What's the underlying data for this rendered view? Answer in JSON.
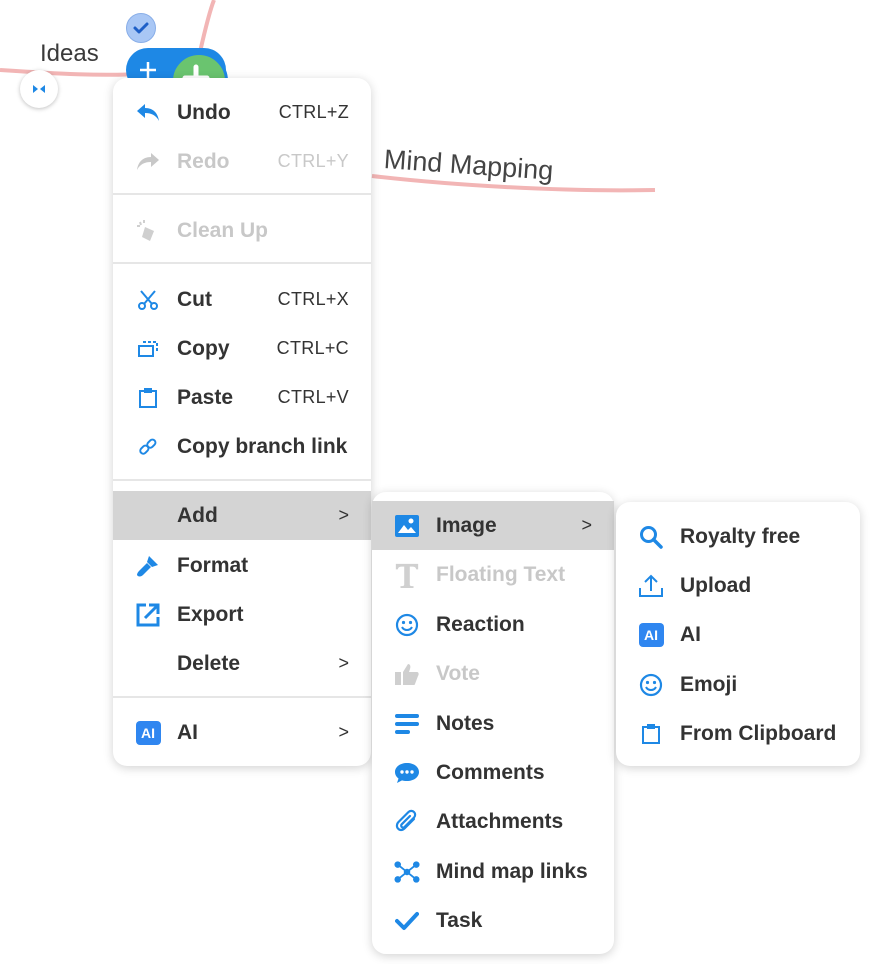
{
  "canvas": {
    "node_ideas": "Ideas",
    "node_mindmap": "Mind Mapping"
  },
  "main_menu": {
    "undo": {
      "label": "Undo",
      "shortcut": "CTRL+Z"
    },
    "redo": {
      "label": "Redo",
      "shortcut": "CTRL+Y"
    },
    "cleanup": {
      "label": "Clean Up"
    },
    "cut": {
      "label": "Cut",
      "shortcut": "CTRL+X"
    },
    "copy": {
      "label": "Copy",
      "shortcut": "CTRL+C"
    },
    "paste": {
      "label": "Paste",
      "shortcut": "CTRL+V"
    },
    "copy_branch": {
      "label": "Copy branch link"
    },
    "add": {
      "label": "Add",
      "arrow": ">"
    },
    "format": {
      "label": "Format"
    },
    "export": {
      "label": "Export"
    },
    "delete": {
      "label": "Delete",
      "arrow": ">"
    },
    "ai": {
      "label": "AI",
      "arrow": ">",
      "badge": "AI"
    }
  },
  "add_menu": {
    "image": {
      "label": "Image",
      "arrow": ">"
    },
    "floating_text": {
      "label": "Floating Text"
    },
    "reaction": {
      "label": "Reaction"
    },
    "vote": {
      "label": "Vote"
    },
    "notes": {
      "label": "Notes"
    },
    "comments": {
      "label": "Comments"
    },
    "attachments": {
      "label": "Attachments"
    },
    "mindmap_links": {
      "label": "Mind map links"
    },
    "task": {
      "label": "Task"
    }
  },
  "image_menu": {
    "royalty_free": {
      "label": "Royalty free"
    },
    "upload": {
      "label": "Upload"
    },
    "ai": {
      "label": "AI",
      "badge": "AI"
    },
    "emoji": {
      "label": "Emoji"
    },
    "clipboard": {
      "label": "From Clipboard"
    }
  },
  "colors": {
    "accent": "#1e88e5",
    "highlight": "#d4d4d4",
    "disabled": "#c8c8c8",
    "branch": "#f2b5b5"
  }
}
